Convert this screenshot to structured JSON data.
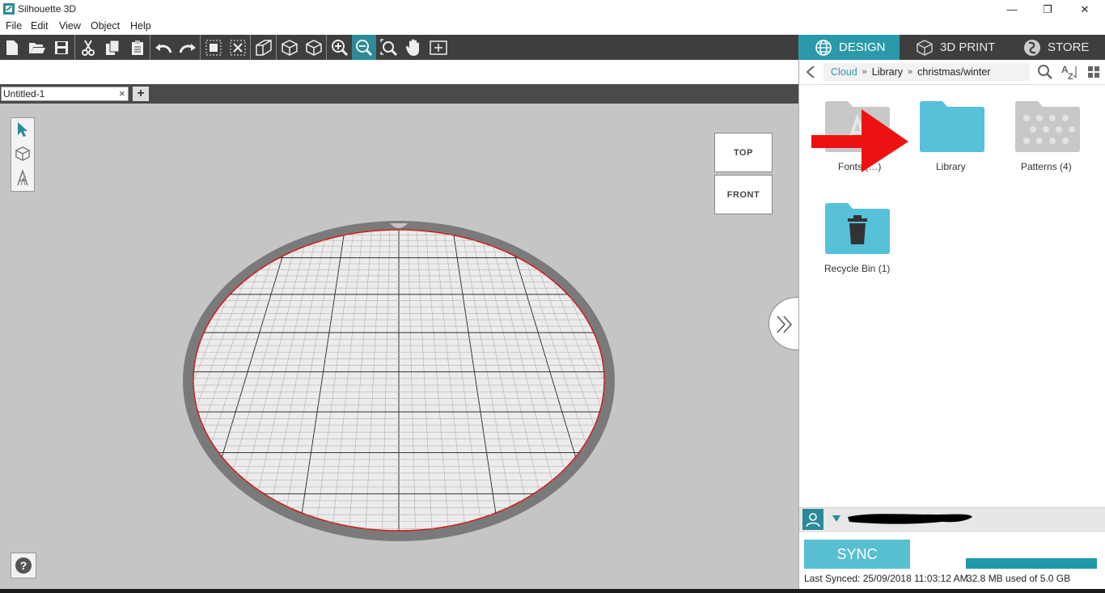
{
  "window": {
    "title": "Silhouette 3D",
    "minimize": "—",
    "restore": "❐",
    "close": "✕"
  },
  "menu": [
    "File",
    "Edit",
    "View",
    "Object",
    "Help"
  ],
  "document": {
    "tab_label": "Untitled-1",
    "close": "×",
    "add": "+"
  },
  "viewcube": {
    "top": "TOP",
    "front": "FRONT"
  },
  "panel": {
    "tabs": [
      {
        "label": "DESIGN",
        "icon": "globe-icon",
        "active": true
      },
      {
        "label": "3D PRINT",
        "icon": "cube-icon",
        "active": false
      },
      {
        "label": "STORE",
        "icon": "store-logo-icon",
        "active": false
      }
    ],
    "breadcrumb": [
      "Cloud",
      "Library",
      "christmas/winter"
    ],
    "folders": [
      {
        "label": "Fonts (…)",
        "icon": "font-folder-icon"
      },
      {
        "label": "Library",
        "icon": "folder-icon"
      },
      {
        "label": "Patterns (4)",
        "icon": "pattern-folder-icon"
      },
      {
        "label": "Recycle Bin (1)",
        "icon": "trash-folder-icon"
      }
    ],
    "sync_label": "SYNC",
    "last_synced": "Last Synced: 25/09/2018 11:03:12 AM",
    "usage": "32.8 MB used of 5.0 GB",
    "usage_fraction": 0.0066
  },
  "colors": {
    "accent": "#2a9aaa",
    "folder": "#56c1d8",
    "arrow": "#ee1111",
    "platform_edge": "#d41a1a"
  }
}
